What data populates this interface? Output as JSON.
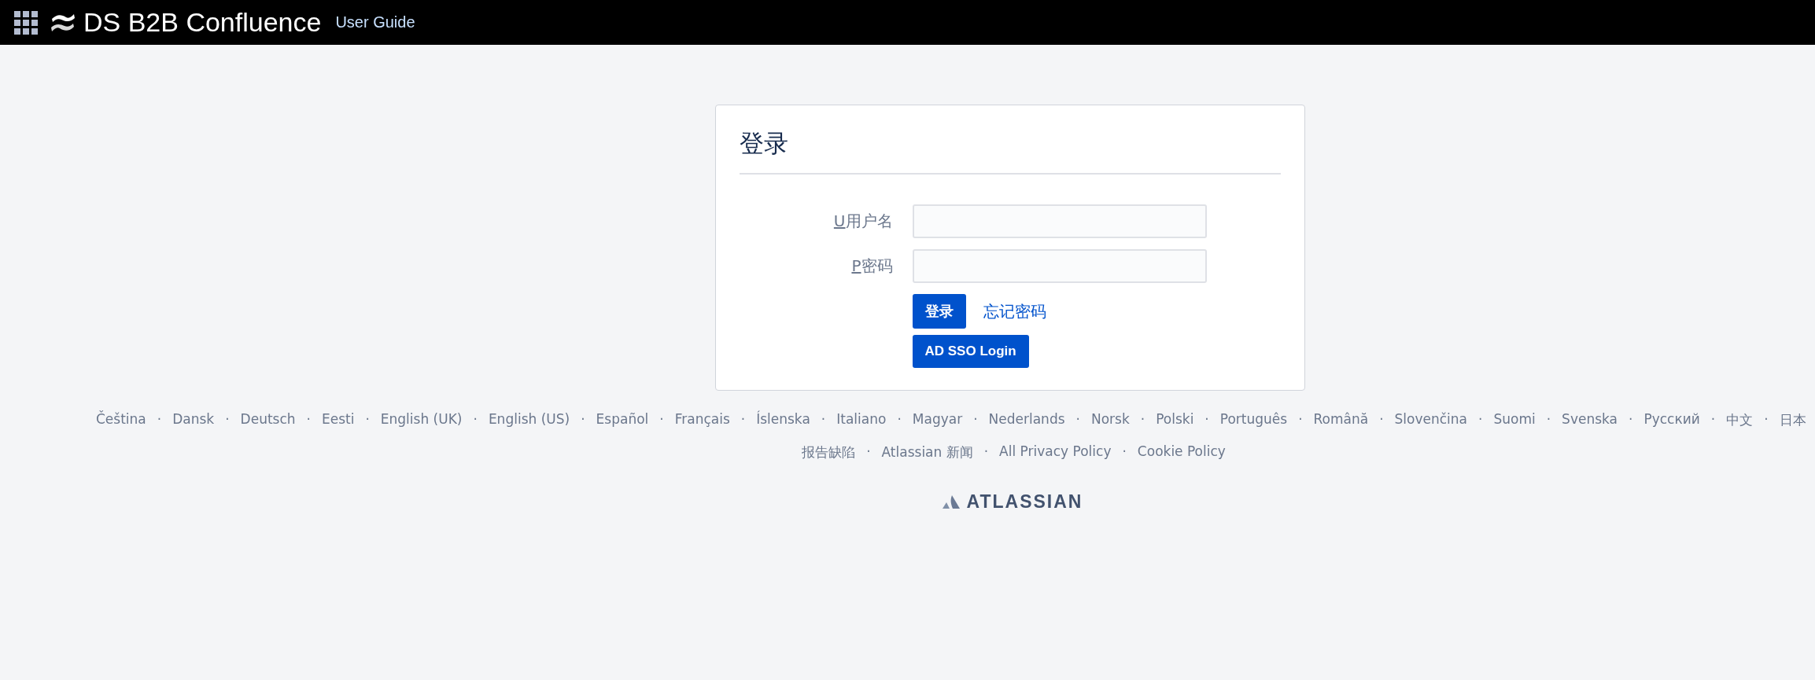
{
  "header": {
    "title": "DS B2B Confluence",
    "link": "User Guide"
  },
  "login": {
    "title": "登录",
    "fields": [
      {
        "accesskey": "U",
        "label": "用户名"
      },
      {
        "accesskey": "P",
        "label": "密码"
      }
    ],
    "submit": "登录",
    "forgot": "忘记密码",
    "sso": "AD SSO Login"
  },
  "languages": [
    "Čeština",
    "Dansk",
    "Deutsch",
    "Eesti",
    "English (UK)",
    "English (US)",
    "Español",
    "Français",
    "Íslenska",
    "Italiano",
    "Magyar",
    "Nederlands",
    "Norsk",
    "Polski",
    "Português",
    "Română",
    "Slovenčina",
    "Suomi",
    "Svenska",
    "Русский",
    "中文",
    "日本"
  ],
  "separator": "·",
  "footer_links": [
    "报告缺陷",
    "Atlassian 新闻",
    "All Privacy Policy",
    "Cookie Policy"
  ],
  "brand": "ATLASSIAN"
}
